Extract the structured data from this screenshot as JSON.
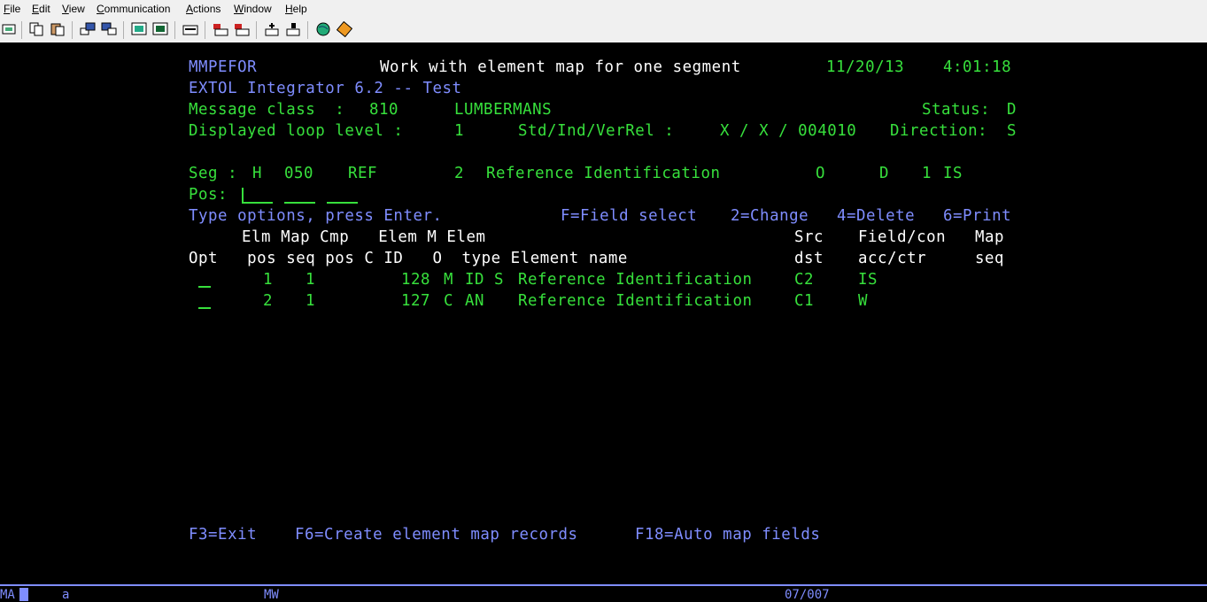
{
  "menu": [
    {
      "label": "File",
      "key": "F",
      "rest": "ile"
    },
    {
      "label": "Edit",
      "key": "E",
      "rest": "dit"
    },
    {
      "label": "View",
      "key": "V",
      "rest": "iew"
    },
    {
      "label": "Communication",
      "key": "C",
      "rest": "ommunication"
    },
    {
      "label": "Actions",
      "key": "A",
      "rest": "ctions"
    },
    {
      "label": "Window",
      "key": "W",
      "rest": "indow"
    },
    {
      "label": "Help",
      "key": "H",
      "rest": "elp"
    }
  ],
  "colors": {
    "green": "#37e03c",
    "blue": "#7f8dff",
    "background": "#000000"
  },
  "screen": {
    "program": "MMPEFOR",
    "title": "Work with element map for one segment",
    "date": "11/20/13",
    "time": "4:01:18",
    "subtitle": "EXTOL Integrator 6.2 -- Test",
    "message_class_label": "Message class  :",
    "message_class_value": "810",
    "partner_name": "LUMBERMANS",
    "status_label": "Status:",
    "status_value": "D",
    "loop_label": "Displayed loop level :",
    "loop_value": "1",
    "std_label": "Std/Ind/VerRel :",
    "std_value": "X / X / 004010",
    "direction_label": "Direction:",
    "direction_value": "S",
    "seg_label": "Seg :",
    "seg_area": "H",
    "seg_seq": "050",
    "seg_id": "REF",
    "seg_max": "2",
    "seg_name": "Reference Identification",
    "seg_req": "O",
    "seg_flag": "D",
    "seg_count": "1",
    "seg_code": "IS",
    "pos_label": "Pos:",
    "instructions": "Type options, press Enter.",
    "options": [
      "F=Field select",
      "2=Change",
      "4=Delete",
      "6=Print"
    ],
    "header1": "Elm Map Cmp   Elem M Elem",
    "header1_src": "Src",
    "header1_field": "Field/con",
    "header1_map": "Map",
    "header2": "Opt   pos seq pos C ID   O  type Element name",
    "header2_src": "dst",
    "header2_field": "acc/ctr",
    "header2_map": "seq",
    "rows": [
      {
        "elm_pos": "1",
        "map_seq": "1",
        "elem_id": "128",
        "mo": "M",
        "type": "ID S",
        "name": "Reference Identification",
        "src": "C2",
        "field": "IS"
      },
      {
        "elm_pos": "2",
        "map_seq": "1",
        "elem_id": "127",
        "mo": "C",
        "type": "AN",
        "name": "Reference Identification",
        "src": "C1",
        "field": "W"
      }
    ],
    "fkeys": [
      "F3=Exit",
      "F6=Create element map records",
      "F18=Auto map fields"
    ]
  },
  "statusbar": {
    "mode": "MA",
    "session": "a",
    "indicator": "MW",
    "position": "07/007"
  },
  "toolbar_icons": [
    "print-screen-icon",
    "copy-icon",
    "paste-icon",
    "send-icon",
    "receive-icon",
    "display-icon",
    "keypad-icon",
    "macro-icon",
    "record-icon",
    "play-icon",
    "run-icon",
    "stop-icon",
    "globe-icon",
    "settings-icon"
  ]
}
